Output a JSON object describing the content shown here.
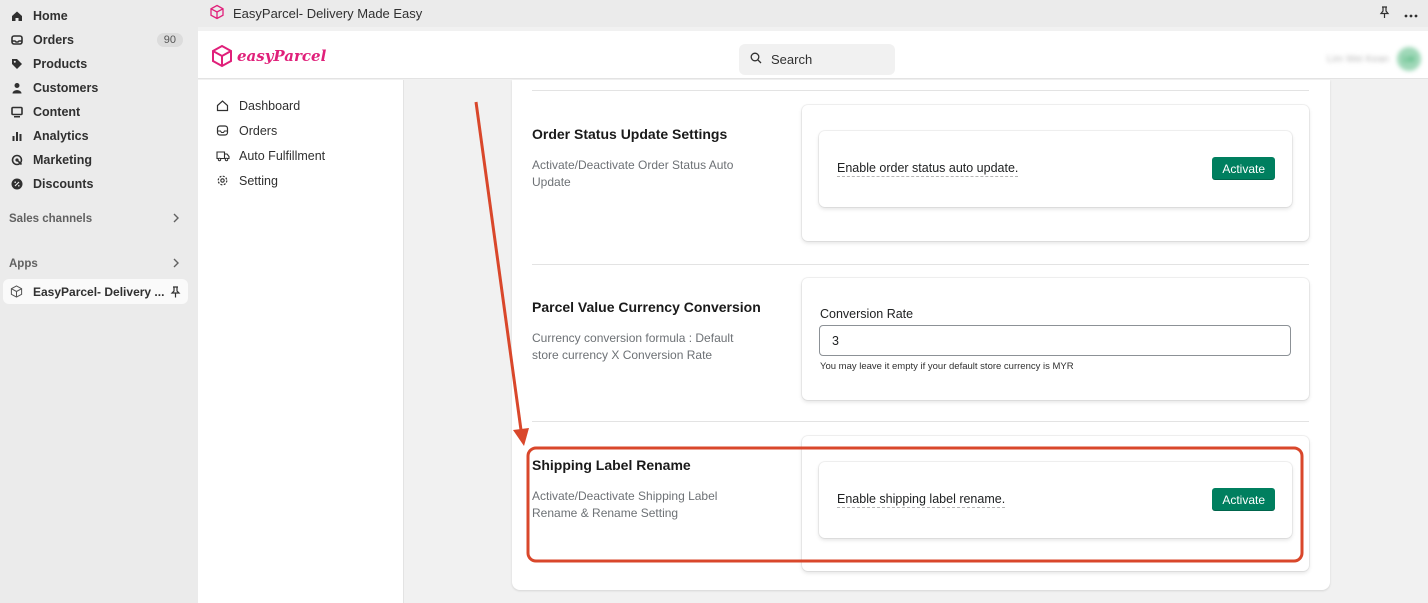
{
  "sidebar": {
    "items": [
      {
        "label": "Home",
        "icon": "home-icon"
      },
      {
        "label": "Orders",
        "icon": "inbox-icon",
        "badge": "90"
      },
      {
        "label": "Products",
        "icon": "tag-icon"
      },
      {
        "label": "Customers",
        "icon": "person-icon"
      },
      {
        "label": "Content",
        "icon": "monitor-icon"
      },
      {
        "label": "Analytics",
        "icon": "bar-chart-icon"
      },
      {
        "label": "Marketing",
        "icon": "target-icon"
      },
      {
        "label": "Discounts",
        "icon": "discount-icon"
      }
    ],
    "sales_channels_label": "Sales channels",
    "apps_label": "Apps",
    "app_item_label": "EasyParcel- Delivery ..."
  },
  "titlebar": {
    "title": "EasyParcel- Delivery Made Easy"
  },
  "header": {
    "logo_text": "easyParcel",
    "search_placeholder": "Search",
    "user_name": "Lim Wei Kean",
    "user_initials": "LW"
  },
  "app_nav": {
    "items": [
      {
        "label": "Dashboard",
        "icon": "home-icon"
      },
      {
        "label": "Orders",
        "icon": "inbox-icon"
      },
      {
        "label": "Auto Fulfillment",
        "icon": "truck-icon"
      },
      {
        "label": "Setting",
        "icon": "gear-icon"
      }
    ]
  },
  "sections": {
    "order_status": {
      "title": "Order Status Update Settings",
      "description": "Activate/Deactivate Order Status Auto Update",
      "toggle_text": "Enable order status auto update.",
      "button_label": "Activate"
    },
    "currency": {
      "title": "Parcel Value Currency Conversion",
      "description": "Currency conversion formula : Default store currency X Conversion Rate",
      "field_label": "Conversion Rate",
      "field_value": "3",
      "help_text": "You may leave it empty if your default store currency is MYR"
    },
    "shipping_label": {
      "title": "Shipping Label Rename",
      "description": "Activate/Deactivate Shipping Label Rename & Rename Setting",
      "toggle_text": "Enable shipping label rename.",
      "button_label": "Activate"
    }
  },
  "colors": {
    "accent_green": "#007f5f",
    "annotation_red": "#d9472b",
    "brand_pink": "#e0207a"
  }
}
